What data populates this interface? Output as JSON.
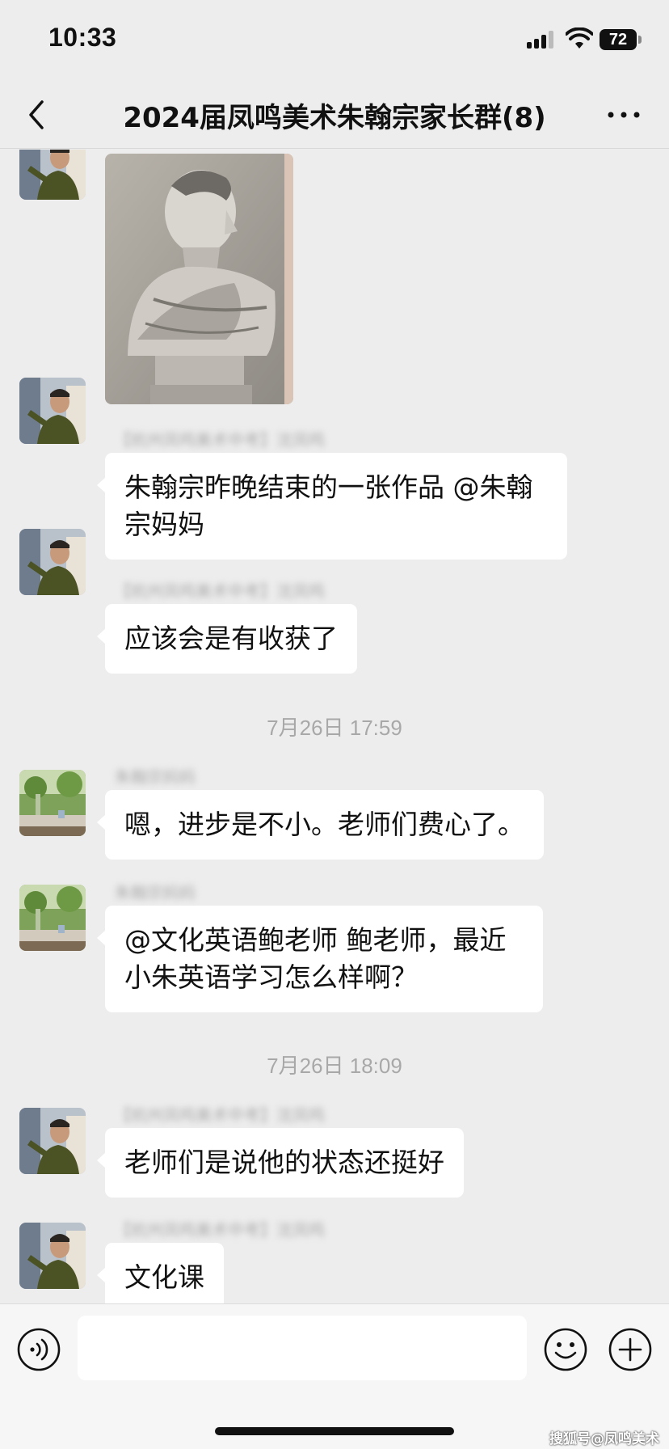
{
  "status_bar": {
    "time": "10:33",
    "battery": "72"
  },
  "nav": {
    "title": "2024届凤鸣美术朱翰宗家长群(8)"
  },
  "messages": [
    {
      "type": "image",
      "sender": "",
      "alt": ""
    },
    {
      "type": "text",
      "sender": "【杭州凤鸣美术中考】沈凤鸣",
      "text_line1": "朱翰宗昨晚结束的一张作品 @朱翰",
      "text_line2": "宗妈妈"
    },
    {
      "type": "text",
      "sender": "【杭州凤鸣美术中考】沈凤鸣",
      "text": "应该会是有收获了"
    },
    {
      "type": "timestamp",
      "text": "7月26日 17:59"
    },
    {
      "type": "text",
      "sender": "朱翰宗妈妈",
      "text": "嗯，进步是不小。老师们费心了。"
    },
    {
      "type": "text",
      "sender": "朱翰宗妈妈",
      "text_line1": "@文化英语鲍老师 鲍老师，最近",
      "text_line2": "小朱英语学习怎么样啊？"
    },
    {
      "type": "timestamp",
      "text": "7月26日 18:09"
    },
    {
      "type": "text",
      "sender": "【杭州凤鸣美术中考】沈凤鸣",
      "text": "老师们是说他的状态还挺好"
    },
    {
      "type": "text",
      "sender": "【杭州凤鸣美术中考】沈凤鸣",
      "text": "文化课"
    }
  ],
  "input": {
    "placeholder": ""
  },
  "watermark": "搜狐号@凤鸣美术",
  "icons": {
    "back": "chevron-left-icon",
    "more": "more-dots-icon",
    "voice": "voice-icon",
    "emoji": "emoji-icon",
    "plus": "plus-icon"
  },
  "colors": {
    "background": "#ededed",
    "bubble": "#ffffff",
    "timestamp": "#a8a8a8"
  }
}
